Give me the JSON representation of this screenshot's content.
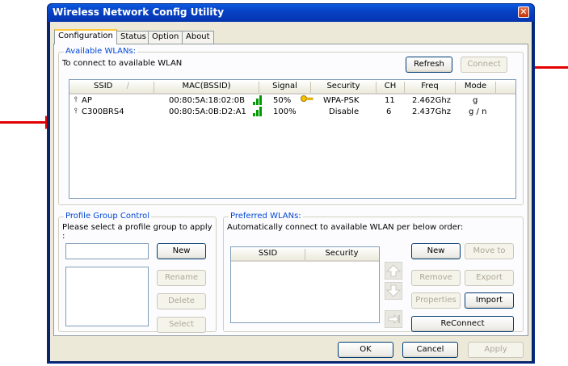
{
  "window": {
    "title": "Wireless Network Config Utility"
  },
  "tabs": [
    "Configuration",
    "Status",
    "Option",
    "About"
  ],
  "available": {
    "legend": "Available WLANs:",
    "hint": "To connect to available WLAN",
    "refresh_label": "Refresh",
    "connect_label": "Connect",
    "columns": [
      "SSID",
      "MAC(BSSID)",
      "Signal",
      "Security",
      "CH",
      "Freq",
      "Mode"
    ],
    "rows": [
      {
        "ssid": "AP",
        "mac": "00:80:5A:18:02:0B",
        "signal": "50%",
        "security": "WPA-PSK",
        "ch": "11",
        "freq": "2.462Ghz",
        "mode": "g",
        "locked": true
      },
      {
        "ssid": "C300BRS4",
        "mac": "00:80:5A:0B:D2:A1",
        "signal": "100%",
        "security": "Disable",
        "ch": "6",
        "freq": "2.437Ghz",
        "mode": "g / n",
        "locked": false
      }
    ]
  },
  "profile": {
    "legend": "Profile Group Control",
    "hint": "Please select a profile group to apply :",
    "new_label": "New",
    "rename_label": "Rename",
    "delete_label": "Delete",
    "select_label": "Select"
  },
  "preferred": {
    "legend": "Preferred WLANs:",
    "hint": "Automatically connect to available WLAN per below order:",
    "columns": [
      "SSID",
      "Security"
    ],
    "new_label": "New",
    "moveto_label": "Move to",
    "remove_label": "Remove",
    "export_label": "Export",
    "properties_label": "Properties",
    "import_label": "Import",
    "reconnect_label": "ReConnect"
  },
  "footer": {
    "ok_label": "OK",
    "cancel_label": "Cancel",
    "apply_label": "Apply"
  },
  "colors": {
    "annotation_arrow": "#e20000",
    "title_blue": "#0842c4",
    "legend_blue": "#0046d5"
  }
}
